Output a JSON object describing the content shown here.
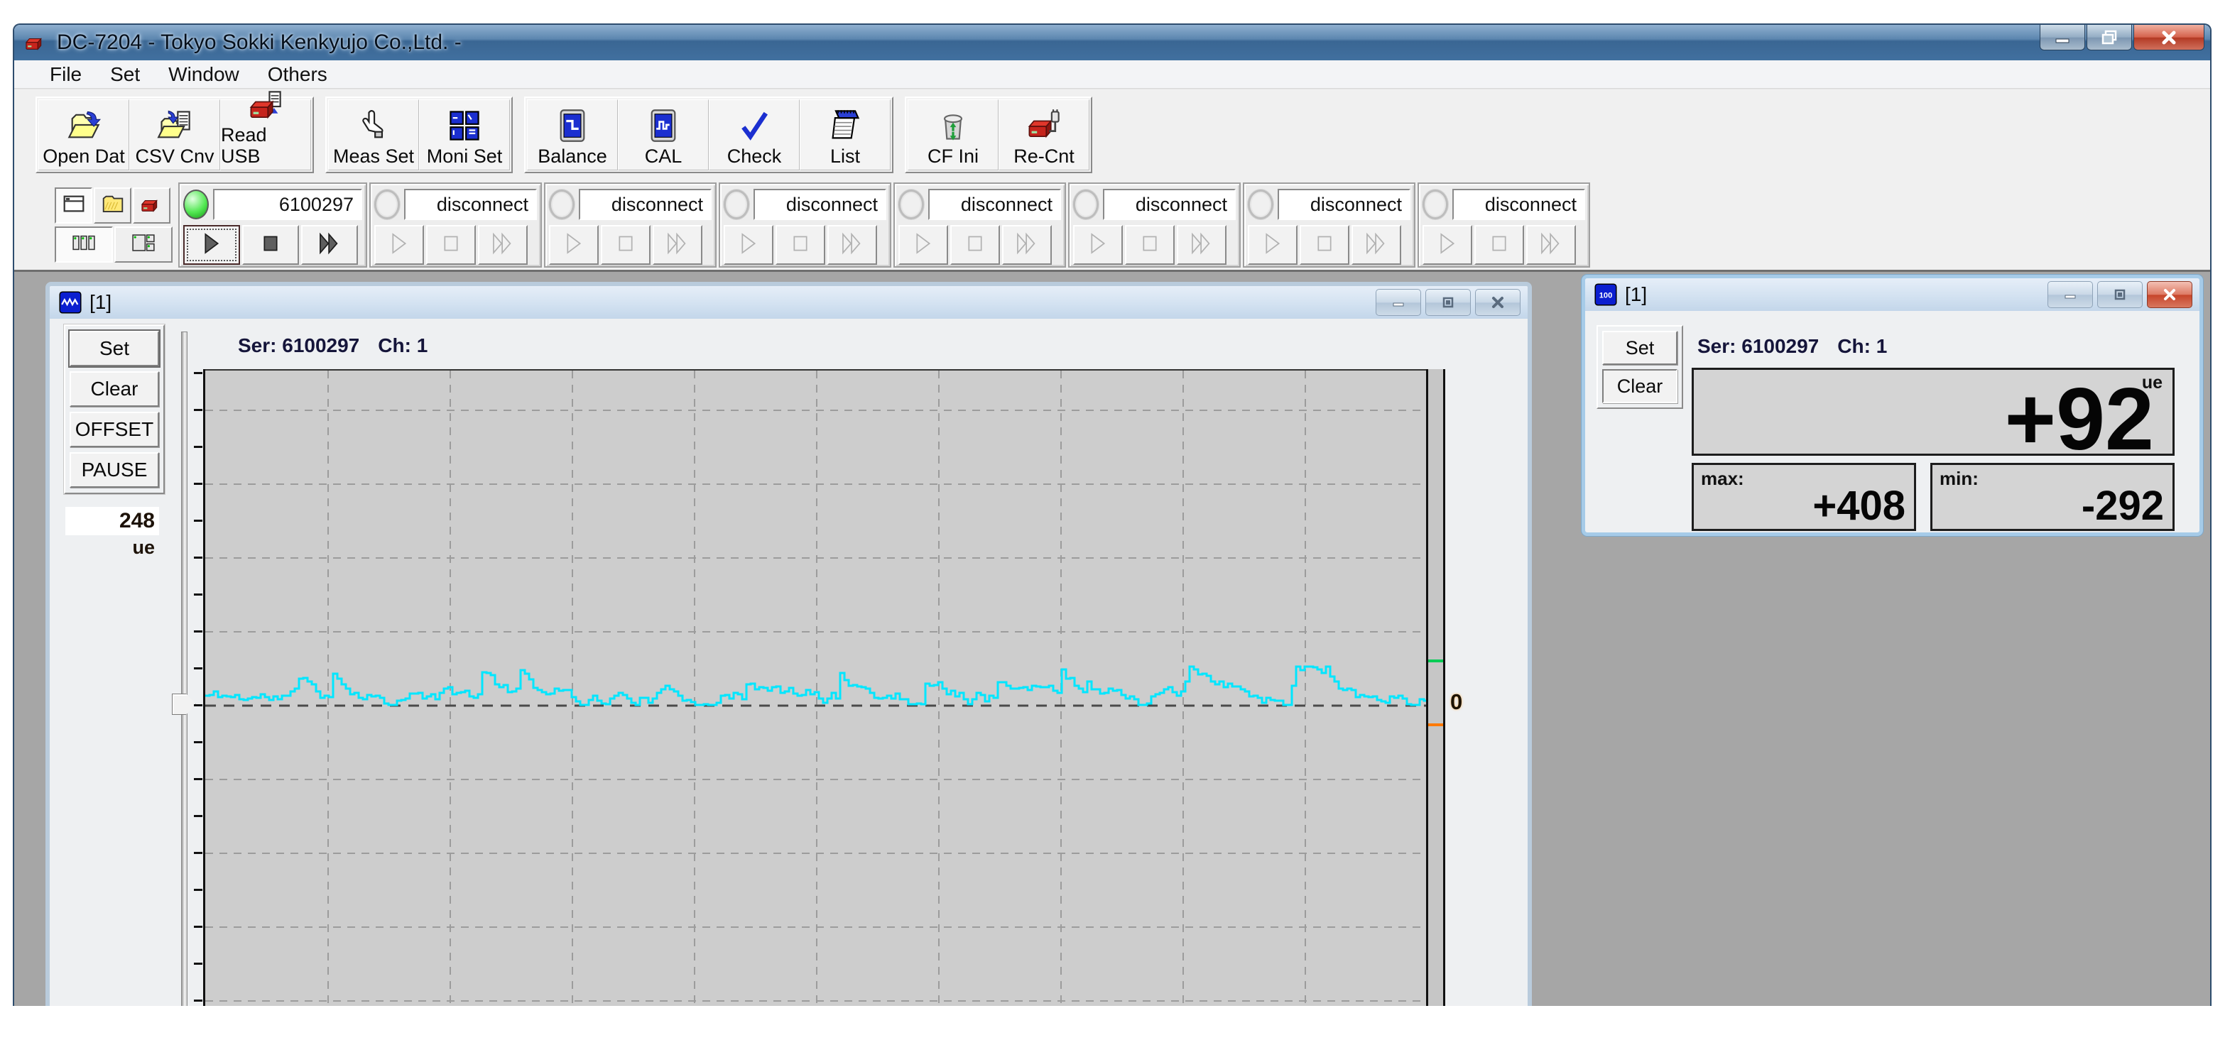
{
  "window": {
    "title": "DC-7204 - Tokyo Sokki Kenkyujo Co.,Ltd. -"
  },
  "menu": {
    "items": [
      "File",
      "Set",
      "Window",
      "Others"
    ]
  },
  "toolbar": {
    "groups": [
      {
        "buttons": [
          {
            "label": "Open Dat",
            "icon": "open-data-icon"
          },
          {
            "label": "CSV Cnv",
            "icon": "csv-convert-icon"
          },
          {
            "label": "Read USB",
            "icon": "read-usb-icon"
          }
        ]
      },
      {
        "buttons": [
          {
            "label": "Meas Set",
            "icon": "measure-settings-icon"
          },
          {
            "label": "Moni Set",
            "icon": "monitor-settings-icon"
          }
        ]
      },
      {
        "buttons": [
          {
            "label": "Balance",
            "icon": "balance-icon"
          },
          {
            "label": "CAL",
            "icon": "calibration-icon"
          },
          {
            "label": "Check",
            "icon": "check-icon"
          },
          {
            "label": "List",
            "icon": "list-icon"
          }
        ]
      },
      {
        "buttons": [
          {
            "label": "CF Ini",
            "icon": "cf-init-icon"
          },
          {
            "label": "Re-Cnt",
            "icon": "reconnect-icon"
          }
        ]
      }
    ]
  },
  "channel_strip": {
    "view_buttons": [
      {
        "icon": "window-view-icon",
        "pressed": true
      },
      {
        "icon": "folder-view-icon",
        "pressed": false
      },
      {
        "icon": "device-view-icon",
        "pressed": false
      }
    ],
    "layout_buttons": [
      {
        "icon": "channel-list-icon",
        "pressed": true
      },
      {
        "icon": "channel-layout-icon",
        "pressed": false
      }
    ],
    "channels": [
      {
        "label": "6100297",
        "connected": true
      },
      {
        "label": "disconnect",
        "connected": false
      },
      {
        "label": "disconnect",
        "connected": false
      },
      {
        "label": "disconnect",
        "connected": false
      },
      {
        "label": "disconnect",
        "connected": false
      },
      {
        "label": "disconnect",
        "connected": false
      },
      {
        "label": "disconnect",
        "connected": false
      },
      {
        "label": "disconnect",
        "connected": false
      }
    ]
  },
  "chart_window": {
    "title": "[1]",
    "buttons": [
      "Set",
      "Clear",
      "OFFSET",
      "PAUSE"
    ],
    "scale_value": "248",
    "scale_unit": "ue",
    "header": {
      "ser": "Ser: 6100297",
      "ch": "Ch: 1"
    },
    "plot": {
      "bg": "#cdcdcd",
      "grid_color": "#9c9c9c",
      "zero_line_color": "#4a4a4a",
      "waveform_color": "#00e6ff",
      "max_marker_color": "#00cc55",
      "min_marker_color": "#ff7a00",
      "zero_label": "0"
    },
    "waveform": {
      "seed": 11
    }
  },
  "digital_window": {
    "title": "[1]",
    "buttons": [
      "Set",
      "Clear"
    ],
    "header": {
      "ser": "Ser: 6100297",
      "ch": "Ch: 1"
    },
    "unit": "ue",
    "value": "+92",
    "max_label": "max:",
    "max_value": "+408",
    "min_label": "min:",
    "min_value": "-292"
  },
  "colors": {
    "titlebar_blue": "#3a6693",
    "led_on": "#52e852",
    "mdi_background": "#a6a6a6"
  }
}
